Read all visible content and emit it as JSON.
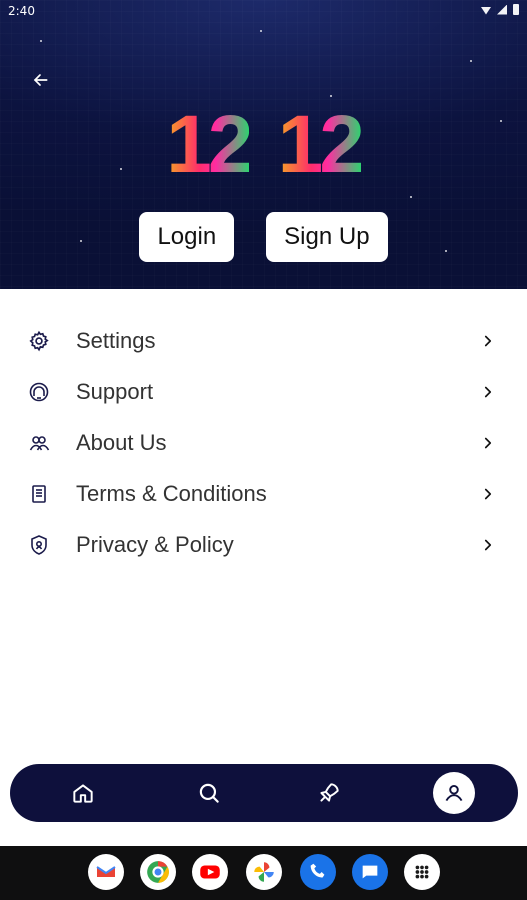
{
  "status": {
    "time": "2:40"
  },
  "header": {
    "logo_left": "12",
    "logo_right": "12",
    "login_label": "Login",
    "signup_label": "Sign Up"
  },
  "menu": {
    "items": [
      {
        "label": "Settings",
        "icon": "gear-icon"
      },
      {
        "label": "Support",
        "icon": "support-icon"
      },
      {
        "label": "About Us",
        "icon": "users-icon"
      },
      {
        "label": "Terms & Conditions",
        "icon": "document-icon"
      },
      {
        "label": "Privacy & Policy",
        "icon": "shield-icon"
      }
    ]
  },
  "bottom_nav": {
    "items": [
      {
        "name": "home",
        "icon": "home-icon"
      },
      {
        "name": "search",
        "icon": "search-icon"
      },
      {
        "name": "rocket",
        "icon": "rocket-icon"
      },
      {
        "name": "profile",
        "icon": "profile-icon"
      }
    ]
  },
  "system_dock": {
    "apps": [
      "Gmail",
      "Chrome",
      "YouTube",
      "Photos",
      "Phone",
      "Messages",
      "App drawer"
    ]
  },
  "colors": {
    "header_bg": "#0c133f",
    "nav_bg": "#0e103c",
    "accent_gradient": [
      "#f5a623",
      "#ff2d6b",
      "#2dd36f"
    ]
  }
}
